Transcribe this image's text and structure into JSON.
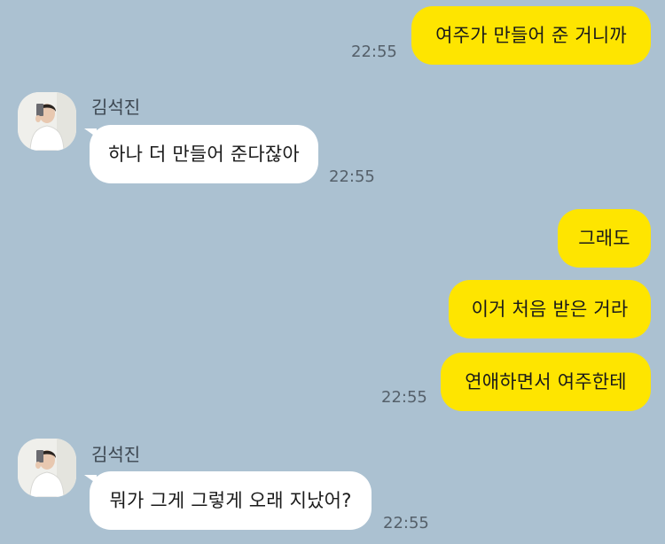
{
  "sender": {
    "name": "김석진"
  },
  "messages": [
    {
      "text": "여주가 만들어 준 거니까",
      "time": "22:55"
    },
    {
      "text": "하나 더 만들어 준다잖아",
      "time": "22:55"
    },
    {
      "text": "그래도"
    },
    {
      "text": "이거 처음 받은 거라"
    },
    {
      "text": "연애하면서 여주한테",
      "time": "22:55"
    },
    {
      "text": "뭐가 그게 그렇게 오래 지났어?",
      "time": "22:55"
    }
  ],
  "colors": {
    "background": "#abc1d1",
    "my_bubble": "#fee500",
    "their_bubble": "#ffffff"
  },
  "icons": {
    "avatar": "avatar-photo-icon"
  }
}
